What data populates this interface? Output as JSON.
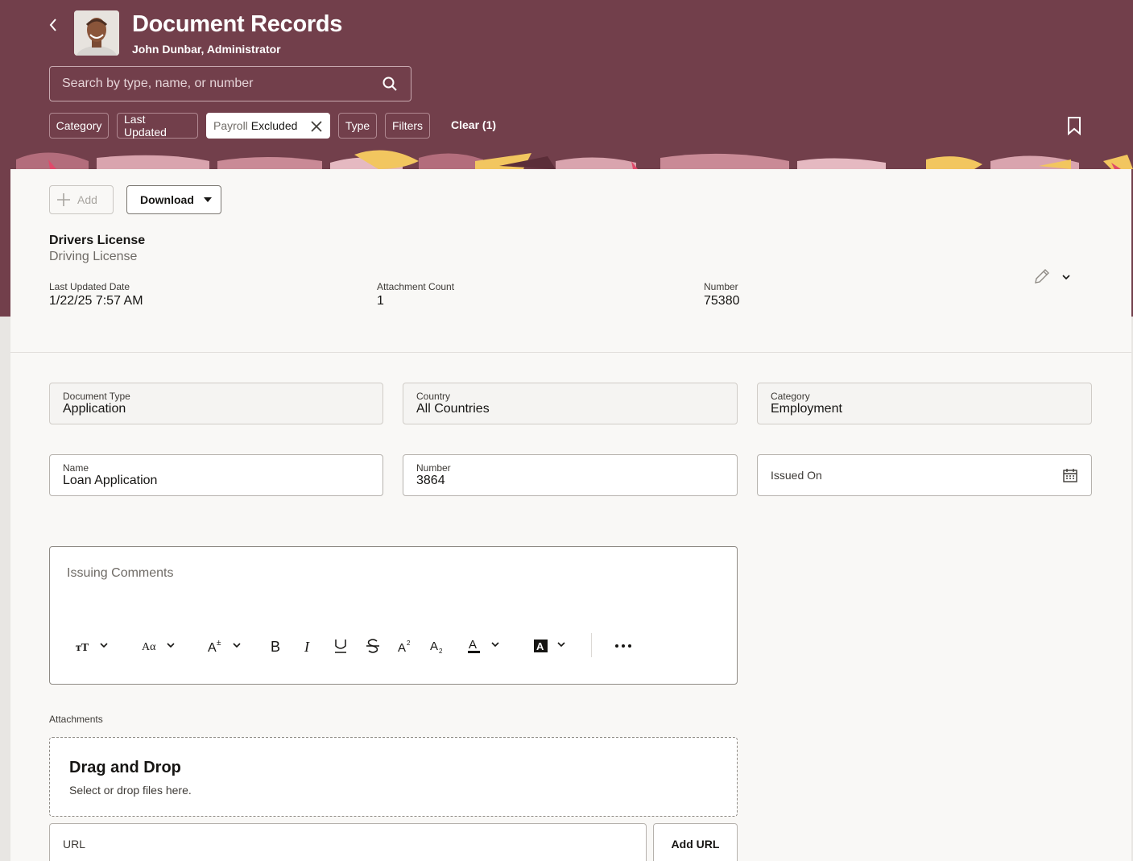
{
  "header": {
    "title": "Document Records",
    "subtitle": "John Dunbar, Administrator",
    "search_placeholder": "Search by type, name, or number"
  },
  "filters": {
    "chips": [
      "Category",
      "Last Updated",
      "Type",
      "Filters"
    ],
    "active_chip": {
      "prefix": "Payroll",
      "value": "Excluded"
    },
    "clear_label": "Clear (1)"
  },
  "toolbar": {
    "add_label": "Add",
    "download_label": "Download"
  },
  "record": {
    "title": "Drivers License",
    "subtitle": "Driving License",
    "meta": [
      {
        "label": "Last Updated Date",
        "value": "1/22/25 7:57 AM"
      },
      {
        "label": "Attachment Count",
        "value": "1"
      },
      {
        "label": "Number",
        "value": "75380"
      }
    ]
  },
  "form": {
    "document_type": {
      "label": "Document Type",
      "value": "Application"
    },
    "country": {
      "label": "Country",
      "value": "All Countries"
    },
    "category": {
      "label": "Category",
      "value": "Employment"
    },
    "name": {
      "label": "Name",
      "value": "Loan Application"
    },
    "number": {
      "label": "Number",
      "value": "3864"
    },
    "issued_on": {
      "label": "Issued On"
    },
    "comments_placeholder": "Issuing Comments"
  },
  "attachments": {
    "label": "Attachments",
    "drop_title": "Drag and Drop",
    "drop_subtitle": "Select or drop files here.",
    "url_placeholder": "URL",
    "add_url_label": "Add URL"
  },
  "colors": {
    "header": "#723f4b",
    "panel": "#f9f8f6",
    "pattern_yellow": "#f2c65f",
    "pattern_pink": "#c77f8c"
  }
}
